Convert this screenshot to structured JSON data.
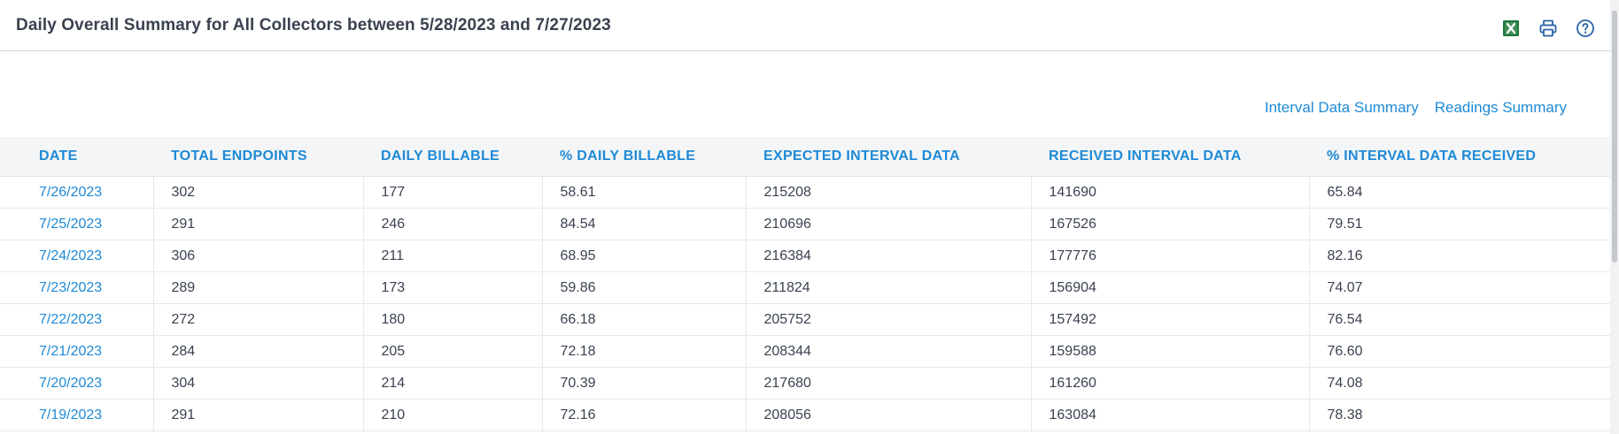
{
  "header": {
    "title": "Daily Overall Summary for All Collectors between 5/28/2023 and 7/27/2023",
    "icons": [
      "excel-export-icon",
      "print-icon",
      "help-icon"
    ],
    "colors": {
      "excel": "#1f7a3a",
      "accent": "#1e8ad6"
    }
  },
  "links": {
    "interval_summary": "Interval Data Summary",
    "readings_summary": "Readings Summary"
  },
  "table": {
    "columns": [
      "DATE",
      "TOTAL ENDPOINTS",
      "DAILY BILLABLE",
      "% DAILY BILLABLE",
      "EXPECTED INTERVAL DATA",
      "RECEIVED INTERVAL DATA",
      "% INTERVAL DATA RECEIVED"
    ],
    "rows": [
      [
        "7/26/2023",
        "302",
        "177",
        "58.61",
        "215208",
        "141690",
        "65.84"
      ],
      [
        "7/25/2023",
        "291",
        "246",
        "84.54",
        "210696",
        "167526",
        "79.51"
      ],
      [
        "7/24/2023",
        "306",
        "211",
        "68.95",
        "216384",
        "177776",
        "82.16"
      ],
      [
        "7/23/2023",
        "289",
        "173",
        "59.86",
        "211824",
        "156904",
        "74.07"
      ],
      [
        "7/22/2023",
        "272",
        "180",
        "66.18",
        "205752",
        "157492",
        "76.54"
      ],
      [
        "7/21/2023",
        "284",
        "205",
        "72.18",
        "208344",
        "159588",
        "76.60"
      ],
      [
        "7/20/2023",
        "304",
        "214",
        "70.39",
        "217680",
        "161260",
        "74.08"
      ],
      [
        "7/19/2023",
        "291",
        "210",
        "72.16",
        "208056",
        "163084",
        "78.38"
      ]
    ]
  }
}
